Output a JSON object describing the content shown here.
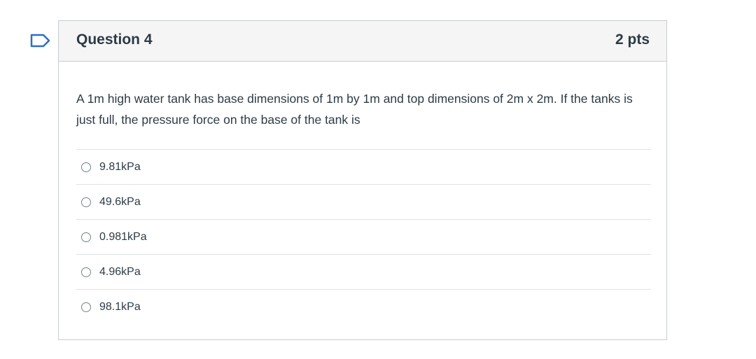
{
  "flag": {
    "icon": "bookmark-flag-icon",
    "color": "#2d6ec3"
  },
  "question": {
    "title": "Question 4",
    "points": "2 pts",
    "text": "A 1m high water tank has base dimensions of 1m by 1m and top dimensions of 2m x 2m. If the tanks is just full, the  pressure force on the base of the tank is",
    "answers": [
      {
        "label": "9.81kPa",
        "selected": false
      },
      {
        "label": "49.6kPa",
        "selected": false
      },
      {
        "label": "0.981kPa",
        "selected": false
      },
      {
        "label": "4.96kPa",
        "selected": false
      },
      {
        "label": "98.1kPa",
        "selected": false
      }
    ]
  }
}
